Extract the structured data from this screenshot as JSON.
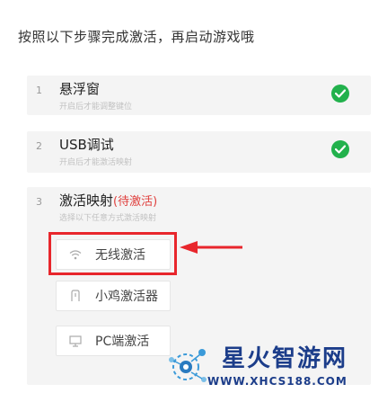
{
  "header": {
    "instruction": "按照以下步骤完成激活，再启动游戏哦"
  },
  "steps": [
    {
      "number": "1",
      "title": "悬浮窗",
      "subtitle": "开启后才能调整键位",
      "done": true
    },
    {
      "number": "2",
      "title": "USB调试",
      "subtitle": "开启后才能激活映射",
      "done": true
    },
    {
      "number": "3",
      "title": "激活映射",
      "status": "(待激活)",
      "subtitle": "选择以下任意方式激活映射",
      "done": false
    }
  ],
  "activation_options": [
    {
      "label": "无线激活",
      "icon": "wifi-icon"
    },
    {
      "label": "小鸡激活器",
      "icon": "chick-icon"
    },
    {
      "label": "PC端激活",
      "icon": "monitor-icon"
    }
  ],
  "colors": {
    "check_green": "#22b14c",
    "highlight_red": "#e8262c",
    "pending_red": "#e0413f",
    "watermark_blue": "#1c3d8a"
  },
  "watermark": {
    "title": "星火智游网",
    "url": "WWW.XHCS188.COM"
  }
}
